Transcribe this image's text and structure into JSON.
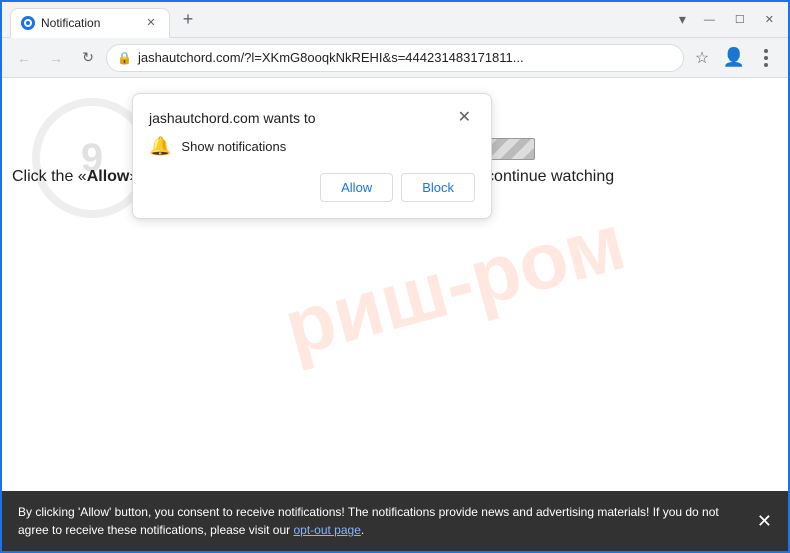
{
  "browser": {
    "tab": {
      "label": "Notification",
      "favicon": "N"
    },
    "new_tab_label": "+",
    "window_controls": {
      "minimize": "—",
      "maximize": "☐",
      "close": "✕"
    },
    "nav": {
      "back": "←",
      "forward": "→",
      "reload": "↻"
    },
    "address": {
      "lock_icon": "🔒",
      "url": "jashautchord.com/?l=XKmG8ooqkNkREHI&s=444231483171811...",
      "star": "☆",
      "account": "👤",
      "menu": "⋮"
    }
  },
  "popup": {
    "title": "jashautchord.com wants to",
    "close_btn": "✕",
    "bell_icon": "🔔",
    "description": "Show notifications",
    "allow_btn": "Allow",
    "block_btn": "Block"
  },
  "page": {
    "loading_bar_visible": true,
    "instruction_text_prefix": "Click the «",
    "instruction_allow": "Allow",
    "instruction_text_suffix": "» button to subscribe to the push notifications and continue watching",
    "watermark": "риш-ром"
  },
  "banner": {
    "text": "By clicking 'Allow' button, you consent to receive notifications! The notifications provide news and advertising materials! If you do not agree to receive these notifications, please visit our ",
    "opt_out_text": "opt-out page",
    "text_end": ".",
    "close_btn": "✕"
  }
}
